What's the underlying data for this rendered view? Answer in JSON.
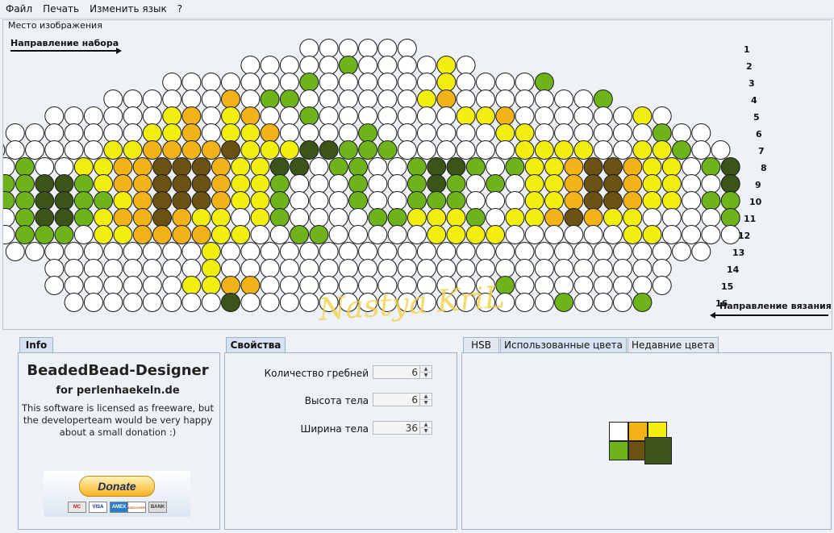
{
  "menu": [
    "Файл",
    "Печать",
    "Изменить язык",
    "?"
  ],
  "canvas": {
    "title": "Место изображения",
    "set_direction": "Направление набора",
    "knit_direction": "Направление вязания",
    "watermark": "Nastya KriL",
    "row_numbers": [
      "1",
      "2",
      "3",
      "4",
      "5",
      "6",
      "7",
      "8",
      "9",
      "10",
      "11",
      "12",
      "13",
      "14",
      "15",
      "16"
    ]
  },
  "pattern": {
    "palette": {
      "W": "#ffffff",
      "Y": "#f2ee10",
      "O": "#f2b319",
      "G": "#6eb31b",
      "B": "#6a5212",
      "D": "#3a5517"
    },
    "rows": [
      "WWWWWW",
      "WWWWWGWWWWYW",
      "WWWWWWWGWWWWWWYWWWWG",
      "WWWWWWOWGGWWWWWWYOWWWWWWWG",
      "WWWWWWYOWYOWWGWWWWWWWYYOWWWWWWYW",
      "WWWWWWWYYOWYYOWWWWGWWWWWWYYWWWWWWGWW",
      "WWWWWWYYOOOOBYYYDDGGGWWWWWWYYYYWWYYGWW",
      "DWGWWYYOOBBBOYYDDWGGWWGDDGWGYYOBBOYYWGD",
      "DGGDDGYOOBBBOYYGWWWGWWGDGWGWYYOBBOYYWWD",
      "WGGDDGGYOBBBOYYGWWWGWWGGGWWWYYOBBOYYWGG",
      "WWGDDGYOOBOYYWYGWWWWGGYYYGWYYOBOYYWWWWG",
      "WWGGGWYYOOOOYYWWGGWWWWWYYYYWWWWWWYYWWWW",
      "WWWWWWWWWWYWWWWWWWWWWWWWWWWWWWWWWWWW",
      "WWWWWWWWYWWWWWWWWWWWWWWWWWWWWWWW",
      "WWWWWWWYYOOWWWWWWWWWWWWGWWWWWWWW",
      "WWWWWWWWDWWWWWWWWWWWWWWWWGWWWG"
    ]
  },
  "tabs": {
    "info": "Info",
    "properties": "Свойства",
    "hsb": "HSB",
    "used_colors": "Использованные цвета",
    "recent_colors": "Недавние цвета"
  },
  "info": {
    "title": "BeadedBead-Designer",
    "subtitle": "for perlenhaekeln.de",
    "text": "This software is licensed as freeware, but the developerteam would be very happy about a small donation :)",
    "donate": "Donate",
    "cards": [
      "MC",
      "VISA",
      "AMEX",
      "DISCOVER",
      "BANK"
    ]
  },
  "properties": {
    "combs_label": "Количество гребней",
    "combs_value": "6",
    "height_label": "Высота тела",
    "height_value": "6",
    "width_label": "Ширина тела",
    "width_value": "36"
  },
  "used_colors": [
    "#ffffff",
    "#f2b319",
    "#f2ee10",
    "#6eb31b",
    "#6a5212",
    "#3a5517"
  ]
}
